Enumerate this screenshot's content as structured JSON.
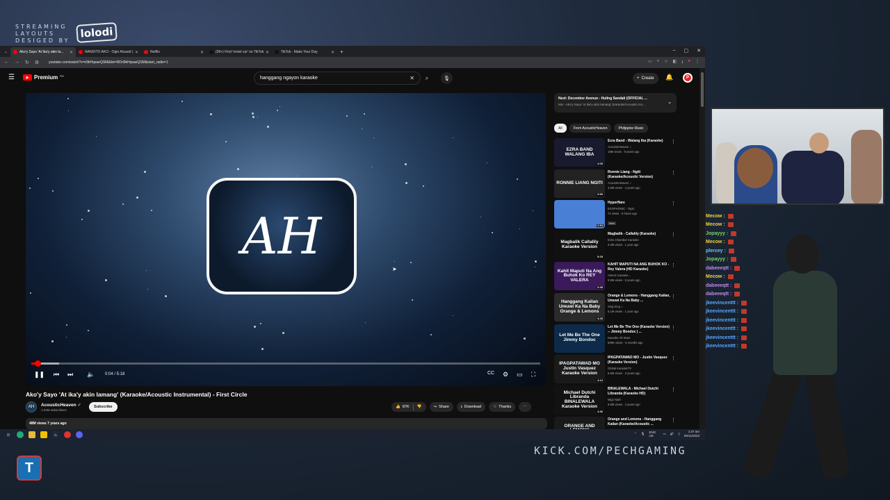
{
  "overlay": {
    "brand_line1": "STREAMING",
    "brand_line2": "LAYOUTS",
    "brand_line3": "DESIGED BY",
    "brand_logo": "lolodi",
    "kick_url": "KICK.COM/PECHGAMING",
    "corner_logo": "T"
  },
  "chat": [
    {
      "name": "Mecow :",
      "color": "#f4d03f"
    },
    {
      "name": "Mecow :",
      "color": "#f4d03f"
    },
    {
      "name": "Jopayyy :",
      "color": "#7bd36a"
    },
    {
      "name": "Mecow :",
      "color": "#f4d03f"
    },
    {
      "name": "plercey :",
      "color": "#6cc7e8"
    },
    {
      "name": "Jopayyy :",
      "color": "#7bd36a"
    },
    {
      "name": "dabeeeqtt :",
      "color": "#c38be8"
    },
    {
      "name": "Mecow :",
      "color": "#f4d03f"
    },
    {
      "name": "dabeeeqtt :",
      "color": "#c38be8"
    },
    {
      "name": "dabeeeqtt :",
      "color": "#c38be8"
    },
    {
      "name": "jkeevincenttt :",
      "color": "#5aa7ff"
    },
    {
      "name": "jkeevincenttt :",
      "color": "#5aa7ff"
    },
    {
      "name": "jkeevincenttt :",
      "color": "#5aa7ff"
    },
    {
      "name": "jkeevincenttt :",
      "color": "#5aa7ff"
    },
    {
      "name": "jkeevincenttt :",
      "color": "#5aa7ff"
    },
    {
      "name": "jkeevincenttt :",
      "color": "#5aa7ff"
    }
  ],
  "browser": {
    "tabs": [
      {
        "title": "Ako'y Sayo 'At Ika'y akin la...",
        "active": true,
        "favicon_color": "#ff0000"
      },
      {
        "title": "NANDITO AKO - Ogie Alcasid (...",
        "active": false,
        "favicon_color": "#ff0000"
      },
      {
        "title": "Netflix",
        "active": false,
        "favicon_color": "#e50914"
      },
      {
        "title": "(99+) Find 'motel car' on TikTok...",
        "active": false,
        "favicon_color": "#111111"
      },
      {
        "title": "TikTok - Make Your Day",
        "active": false,
        "favicon_color": "#111111"
      }
    ],
    "new_tab": "+",
    "url": "youtube.com/watch?v=ri9kHqsaeQSM&list=RDri9kHqsaeQSM&start_radio=1"
  },
  "youtube": {
    "logo_text": "Premium",
    "logo_sup": "PH",
    "search_value": "hanggang ngayon karaoke",
    "create_label": "Create",
    "avatar_letter": "P",
    "player": {
      "logo_text": "AH",
      "time": "0:04 / 5:18",
      "progress_fraction": 0.0126,
      "buffered_fraction": 0.055
    },
    "video": {
      "title": "Ako'y Sayo 'At ika'y akin lamang' (Karaoke/Acoustic Instrumental) - First Circle",
      "channel": "AcousticHeaven",
      "subscribers": "1.04M subscribers",
      "subscribe_label": "Subscribe",
      "likes": "87K",
      "share_label": "Share",
      "download_label": "Download",
      "thanks_label": "Thanks",
      "views_line": "48M views  7 years ago"
    },
    "next_up": {
      "title": "Next: December Avenue - Huling Sandali (OFFICIAL ...",
      "subtitle": "Mix - Ako'y Sayo 'At ika'y akin lamang' (Karaoke/Acoustic Ins..."
    },
    "chips": [
      "All",
      "From AcousticHeaven",
      "Philippine Music"
    ],
    "recommendations": [
      {
        "title": "Ezra Band - Walang Iba (Karaoke)",
        "channel": "AcousticHeaven ✓",
        "meta": "18M views · 8 years ago",
        "thumb_text": "EZRA BAND WALANG IBA",
        "duration": "4:09",
        "thumb_bg": "#1a1a2e",
        "badge": ""
      },
      {
        "title": "Ronnie Liang - Ngiti (Karaoke/Acoustic Version)",
        "channel": "AcousticHeaven ✓",
        "meta": "3.5M views · 4 years ago",
        "thumb_text": "RONNIE LIANG NGITI",
        "duration": "3:50",
        "thumb_bg": "#222222",
        "badge": ""
      },
      {
        "title": "Hyperflare",
        "channel": "EXOPHONIC - Topic",
        "meta": "74 views · 5 hours ago",
        "thumb_text": "",
        "duration": "2:54",
        "thumb_bg": "#4a7fd6",
        "badge": "New"
      },
      {
        "title": "Magbalik - Callalily (Karaoke)",
        "channel": "Echo Chamber Karaoke",
        "meta": "3.3M views · 1 year ago",
        "thumb_text": "Magbalik Callalily Karaoke Version",
        "duration": "5:25",
        "thumb_bg": "#111111",
        "badge": ""
      },
      {
        "title": "KAHIT MAPUTI NA ANG BUHOK KO - Rey Valera (HD Karaoke)",
        "channel": "Atomic Karaoke...",
        "meta": "9.9M views · 5 years ago",
        "thumb_text": "Kahit Maputi Na Ang Buhok Ko REY VALERA",
        "duration": "3:38",
        "thumb_bg": "#3a1a5a",
        "badge": ""
      },
      {
        "title": "Orange & Lemons - Hanggang Kailan, Umuwi Ka Na Baby ...",
        "channel": "Sing King ✓",
        "meta": "5.1M views · 1 year ago",
        "thumb_text": "Hanggang Kailan Umuwi Ka Na Baby Orange & Lemons",
        "duration": "4:28",
        "thumb_bg": "#2a2a2a",
        "badge": ""
      },
      {
        "title": "Let Me Be The One (Karaoke Version) -- Jimmy Bondoc | ...",
        "channel": "Karaoke All-Stars",
        "meta": "509K views · 5 months ago",
        "thumb_text": "Let Me Be The One Jimmy Bondoc",
        "duration": "",
        "thumb_bg": "#0d2a4a",
        "badge": ""
      },
      {
        "title": "IPAGPATAWAD MO - Justin Vasquez (Karaoke Version)",
        "channel": "Global KaraokeTV",
        "meta": "5.6M views · 3 years ago",
        "thumb_text": "IPAGPATAWAD MO Justin Vasquez Karaoke Version",
        "duration": "4:13",
        "thumb_bg": "#1a1a1a",
        "badge": ""
      },
      {
        "title": "BINALEWALA - Michael Dutchi Libranda (Karaoke HD)",
        "channel": "Migz Nath",
        "meta": "9.9M views · 2 years ago",
        "thumb_text": "Michael Dutchi Libranda BINALEWALA Karaoke Version",
        "duration": "4:36",
        "thumb_bg": "#121212",
        "badge": ""
      },
      {
        "title": "Orange and Lemons - Hanggang Kailan (Karaoke/Acoustic ...",
        "channel": "",
        "meta": "",
        "thumb_text": "ORANGE AND LEMONS HANGGANG",
        "duration": "",
        "thumb_bg": "#1a1a1a",
        "badge": ""
      }
    ]
  },
  "taskbar": {
    "lang": "ENG US",
    "time": "1:37 am",
    "date": "09/11/2023"
  }
}
